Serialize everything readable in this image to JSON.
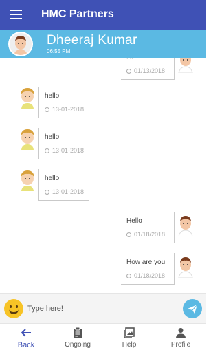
{
  "app": {
    "title": "HMC Partners",
    "colors": {
      "appbar": "#3f51b5",
      "contact_bar": "#5bb9e3",
      "accent": "#5bb9e3"
    }
  },
  "contact": {
    "name": "Dheeraj Kumar",
    "time": "06:55 PM",
    "avatar_icon": "male-avatar-icon"
  },
  "messages": [
    {
      "direction": "sent",
      "text": "Hi",
      "date": "01/13/2018"
    },
    {
      "direction": "received",
      "text": "hello",
      "date": "13-01-2018"
    },
    {
      "direction": "received",
      "text": "hello",
      "date": "13-01-2018"
    },
    {
      "direction": "received",
      "text": "hello",
      "date": "13-01-2018"
    },
    {
      "direction": "sent",
      "text": "Hello",
      "date": "01/18/2018"
    },
    {
      "direction": "sent",
      "text": "How are you",
      "date": "01/18/2018"
    }
  ],
  "composer": {
    "placeholder": "Type here!",
    "emoji_icon": "smiley-emoji-icon",
    "send_icon": "paper-plane-icon"
  },
  "nav": [
    {
      "label": "Back",
      "icon": "arrow-left-icon",
      "active": true
    },
    {
      "label": "Ongoing",
      "icon": "clipboard-icon",
      "active": false
    },
    {
      "label": "Help",
      "icon": "photo-library-icon",
      "active": false
    },
    {
      "label": "Profile",
      "icon": "person-icon",
      "active": false
    }
  ]
}
